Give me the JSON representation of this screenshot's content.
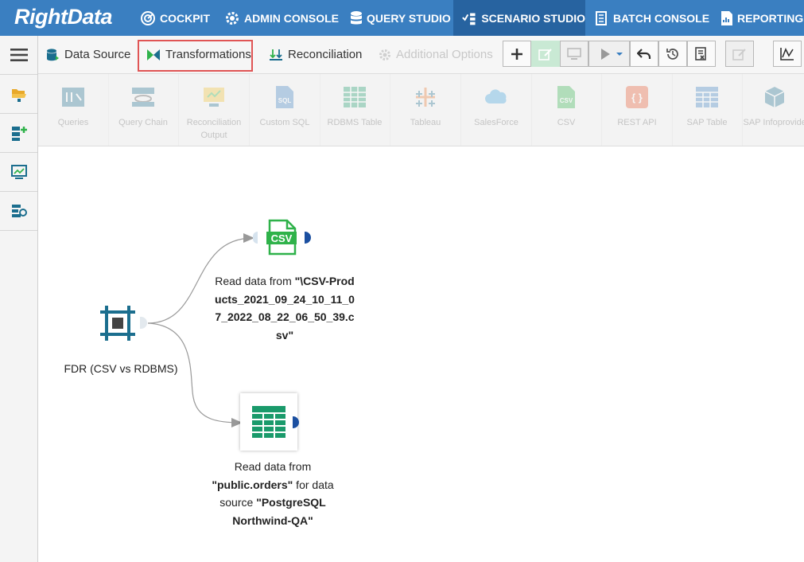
{
  "brand": {
    "logo": "RightData"
  },
  "nav": [
    {
      "label": "COCKPIT",
      "icon": "cockpit-icon"
    },
    {
      "label": "ADMIN CONSOLE",
      "icon": "gear-icon"
    },
    {
      "label": "QUERY STUDIO",
      "icon": "database-icon"
    },
    {
      "label": "SCENARIO STUDIO",
      "icon": "scenario-icon",
      "active": true
    },
    {
      "label": "BATCH CONSOLE",
      "icon": "batch-icon"
    },
    {
      "label": "REPORTING",
      "icon": "report-icon"
    }
  ],
  "tabs": {
    "data_source": "Data Source",
    "transformations": "Transformations",
    "reconciliation": "Reconciliation",
    "additional_options": "Additional Options"
  },
  "ribbon": [
    {
      "label": "Queries"
    },
    {
      "label": "Query Chain"
    },
    {
      "label": "Reconciliation Output"
    },
    {
      "label": "Custom SQL"
    },
    {
      "label": "RDBMS Table"
    },
    {
      "label": "Tableau"
    },
    {
      "label": "SalesForce"
    },
    {
      "label": "CSV"
    },
    {
      "label": "REST API"
    },
    {
      "label": "SAP Table"
    },
    {
      "label": "SAP Infoprovider"
    }
  ],
  "nodes": {
    "fdr": {
      "label": "FDR (CSV vs RDBMS)"
    },
    "csv": {
      "icon_text": "CSV",
      "prefix": "Read data from ",
      "file": "\"\\CSV-Products_2021_09_24_10_11_07_2022_08_22_06_50_39.csv\""
    },
    "rdbms": {
      "prefix": "Read data from ",
      "table": "\"public.orders\"",
      "mid": " for data source ",
      "source": "\"PostgreSQL Northwind-QA\""
    }
  },
  "colors": {
    "topbar": "#3a7fc1",
    "active_nav": "#2763a0",
    "accent_teal": "#1b6e8e",
    "csv_green": "#2fb24a",
    "table_green": "#1a9a6b"
  }
}
